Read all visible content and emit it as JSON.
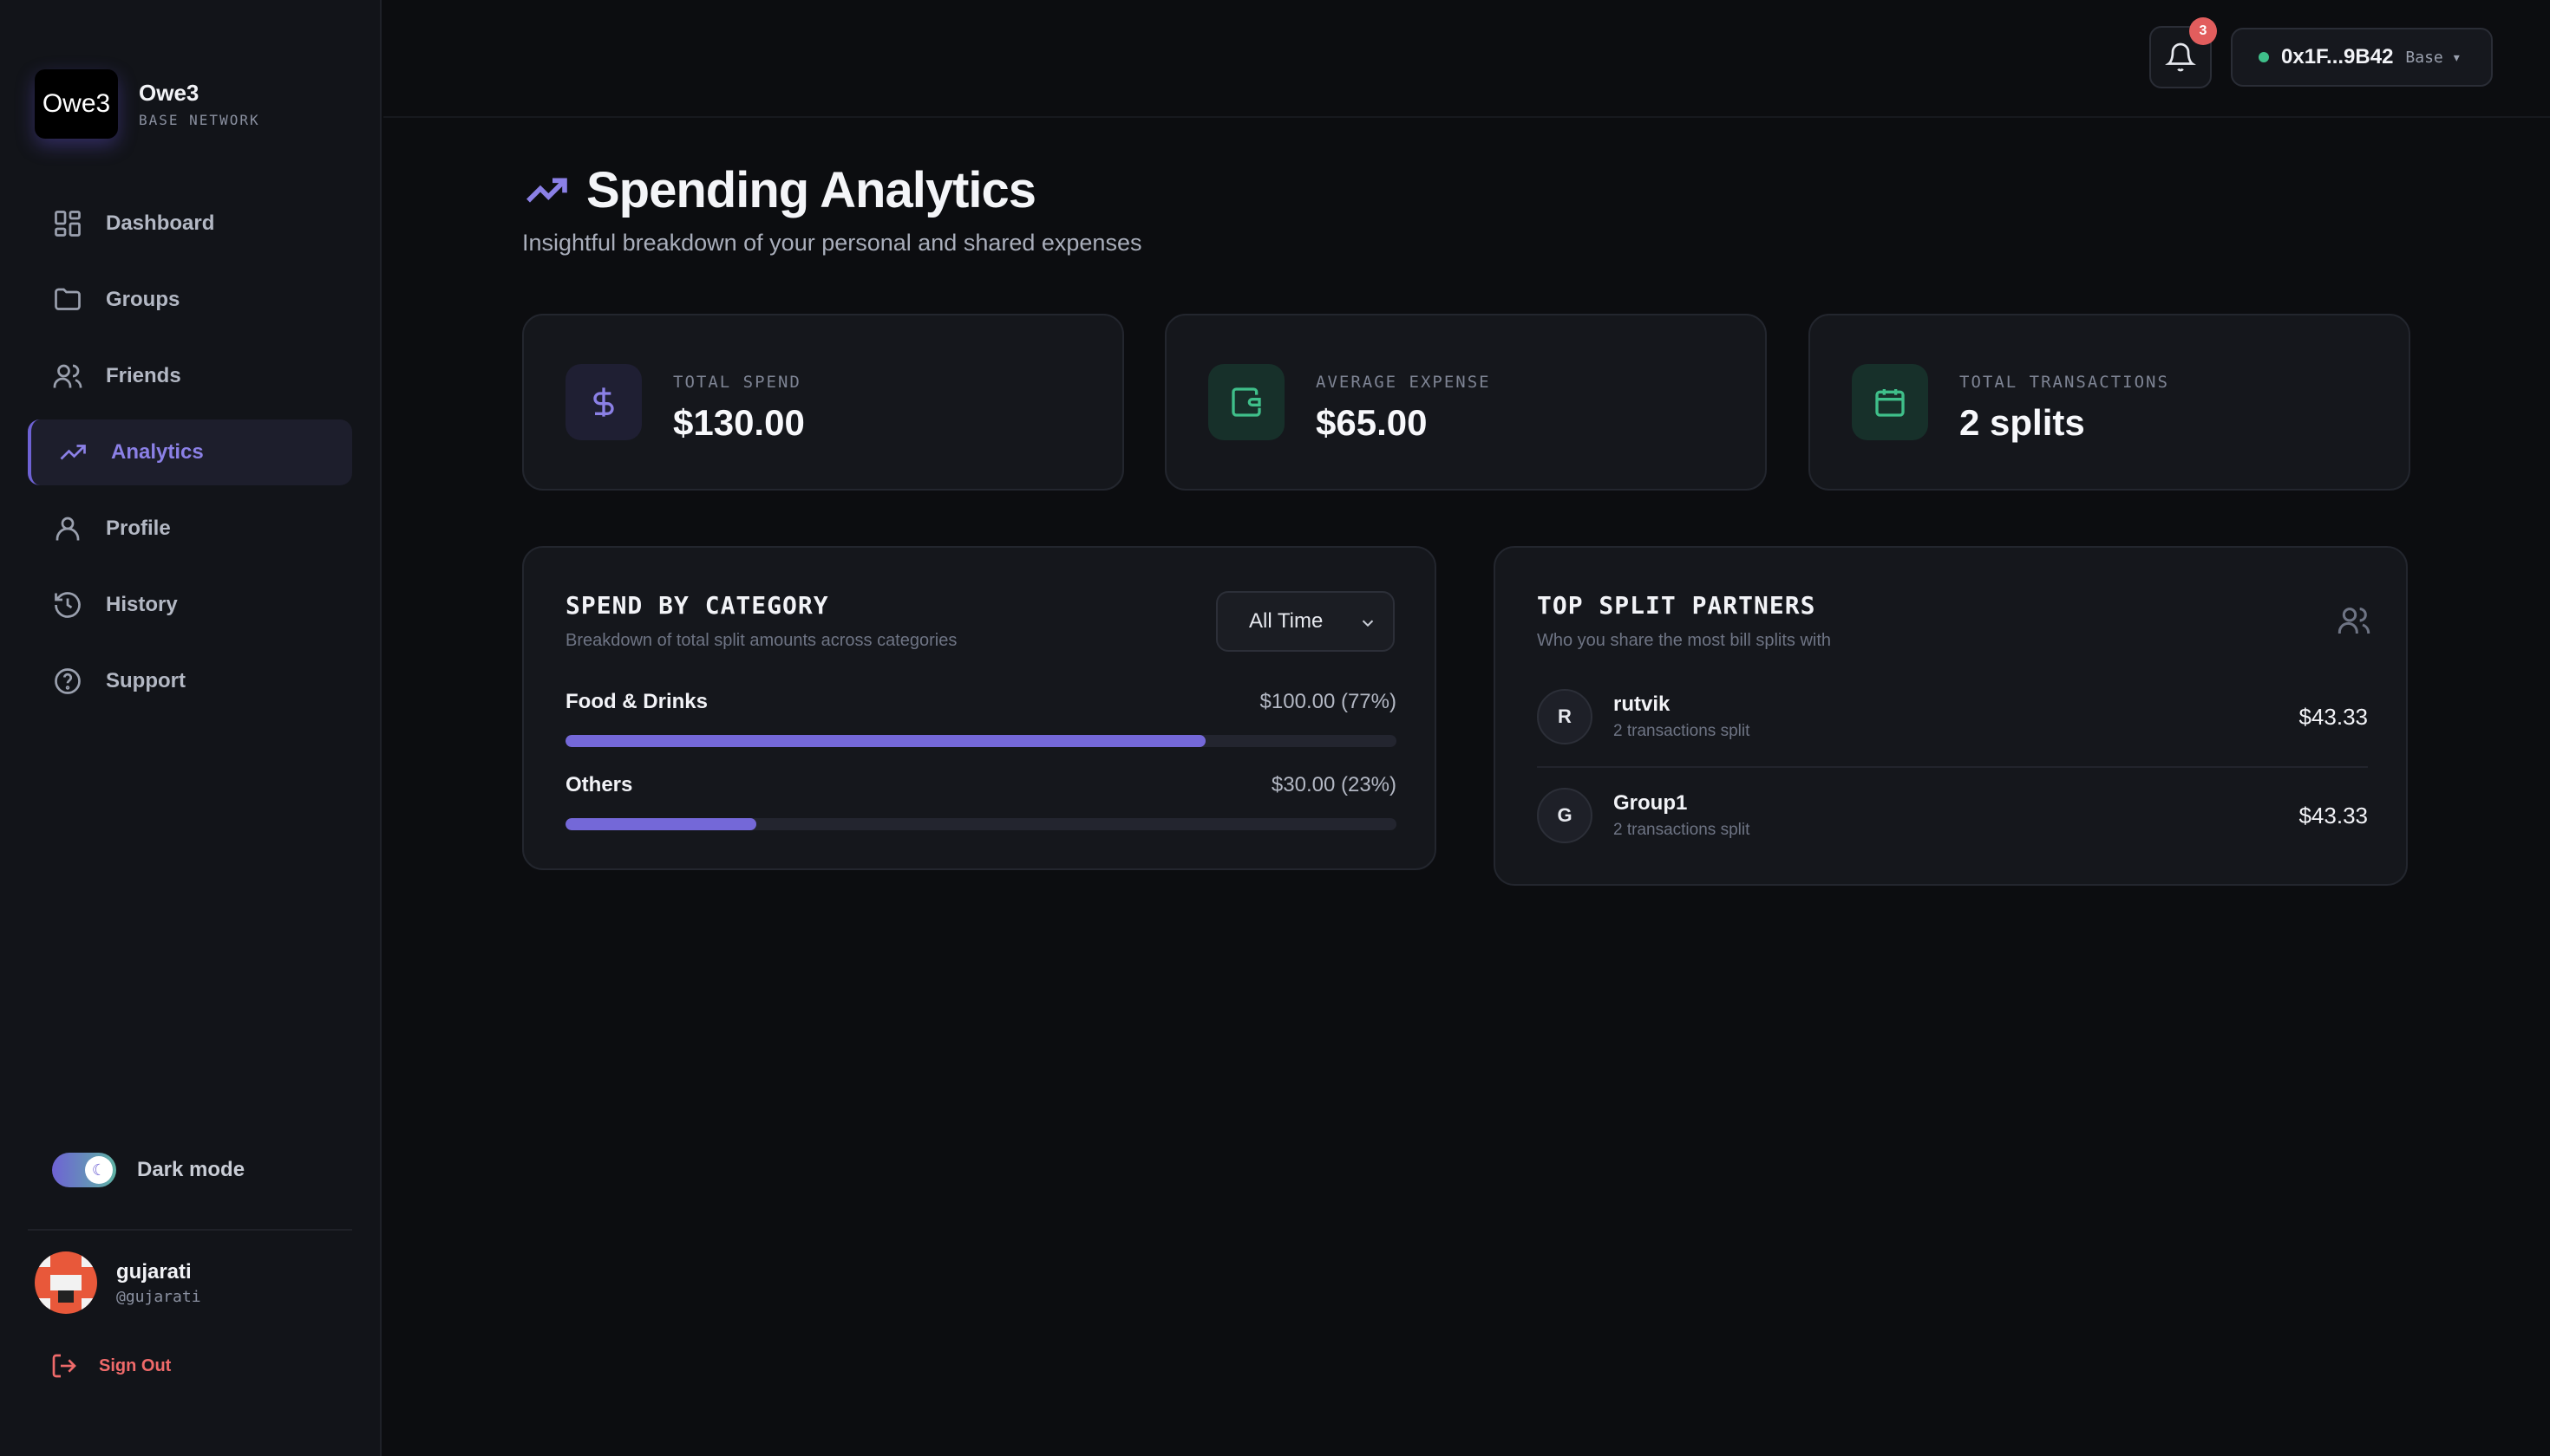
{
  "brand": {
    "logo_text": "Owe3",
    "name": "Owe3",
    "network": "BASE NETWORK"
  },
  "nav": [
    {
      "label": "Dashboard",
      "icon": "grid-icon"
    },
    {
      "label": "Groups",
      "icon": "folder-icon"
    },
    {
      "label": "Friends",
      "icon": "users-icon"
    },
    {
      "label": "Analytics",
      "icon": "trending-up-icon",
      "active": true
    },
    {
      "label": "Profile",
      "icon": "user-icon"
    },
    {
      "label": "History",
      "icon": "history-icon"
    },
    {
      "label": "Support",
      "icon": "help-circle-icon"
    }
  ],
  "theme_toggle": {
    "label": "Dark mode",
    "enabled": true
  },
  "user": {
    "name": "gujarati",
    "handle": "@gujarati"
  },
  "sign_out": "Sign Out",
  "topbar": {
    "notification_count": "3",
    "wallet_address": "0x1F...9B42",
    "network": "Base",
    "caret": "▾"
  },
  "page": {
    "title": "Spending Analytics",
    "subtitle": "Insightful breakdown of your personal and shared expenses"
  },
  "stats": [
    {
      "label": "TOTAL SPEND",
      "value": "$130.00",
      "icon": "dollar-icon"
    },
    {
      "label": "AVERAGE EXPENSE",
      "value": "$65.00",
      "icon": "wallet-icon"
    },
    {
      "label": "TOTAL TRANSACTIONS",
      "value": "2 splits",
      "icon": "calendar-icon"
    }
  ],
  "category_panel": {
    "title": "SPEND BY CATEGORY",
    "subtitle": "Breakdown of total split amounts across categories",
    "filter": "All Time",
    "categories": [
      {
        "name": "Food & Drinks",
        "amount": "$100.00 (77%)",
        "percent": 77
      },
      {
        "name": "Others",
        "amount": "$30.00 (23%)",
        "percent": 23
      }
    ]
  },
  "partners_panel": {
    "title": "TOP SPLIT PARTNERS",
    "subtitle": "Who you share the most bill splits with",
    "partners": [
      {
        "initial": "R",
        "name": "rutvik",
        "meta": "2 transactions split",
        "amount": "$43.33"
      },
      {
        "initial": "G",
        "name": "Group1",
        "meta": "2 transactions split",
        "amount": "$43.33"
      }
    ]
  },
  "colors": {
    "accent": "#7468d8",
    "accent_light": "#8b80e6",
    "green": "#3fbf8a",
    "danger": "#ef6a6a",
    "background": "#0c0d10",
    "card": "#15171c"
  }
}
